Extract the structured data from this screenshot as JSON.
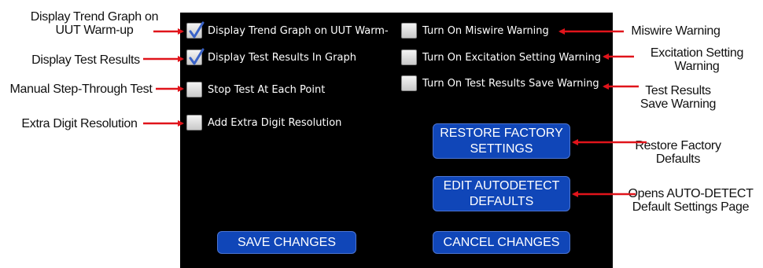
{
  "options_left": [
    {
      "label": "Display Trend Graph on UUT Warm-",
      "checked": true
    },
    {
      "label": "Display Test Results In Graph",
      "checked": true
    },
    {
      "label": "Stop Test At Each Point",
      "checked": false
    },
    {
      "label": "Add Extra Digit Resolution",
      "checked": false
    }
  ],
  "options_right": [
    {
      "label": "Turn On Miswire Warning",
      "checked": false
    },
    {
      "label": "Turn On Excitation Setting Warning",
      "checked": false
    },
    {
      "label": "Turn On Test Results Save Warning",
      "checked": false
    }
  ],
  "buttons": {
    "restore_line1": "RESTORE FACTORY",
    "restore_line2": "SETTINGS",
    "edit_line1": "EDIT AUTODETECT",
    "edit_line2": "DEFAULTS",
    "save": "SAVE CHANGES",
    "cancel": "CANCEL CHANGES"
  },
  "callouts": {
    "trend_line1": "Display Trend Graph on",
    "trend_line2": "UUT Warm-up",
    "test_results": "Display Test Results",
    "manual_step": "Manual Step-Through Test",
    "extra_digit": "Extra Digit Resolution",
    "miswire": "Miswire Warning",
    "excitation_line1": "Excitation Setting",
    "excitation_line2": "Warning",
    "save_warning_line1": "Test Results",
    "save_warning_line2": "Save Warning",
    "restore_line1": "Restore Factory",
    "restore_line2": "Defaults",
    "autodetect_line1": "Opens AUTO-DETECT",
    "autodetect_line2": "Default Settings Page"
  },
  "colors": {
    "panel_bg": "#000000",
    "button_bg": "#1046b8",
    "arrow": "#e0141b",
    "check": "#3a63c8"
  },
  "icons": {
    "check": "checkmark-icon",
    "arrow": "red-arrow-icon"
  }
}
